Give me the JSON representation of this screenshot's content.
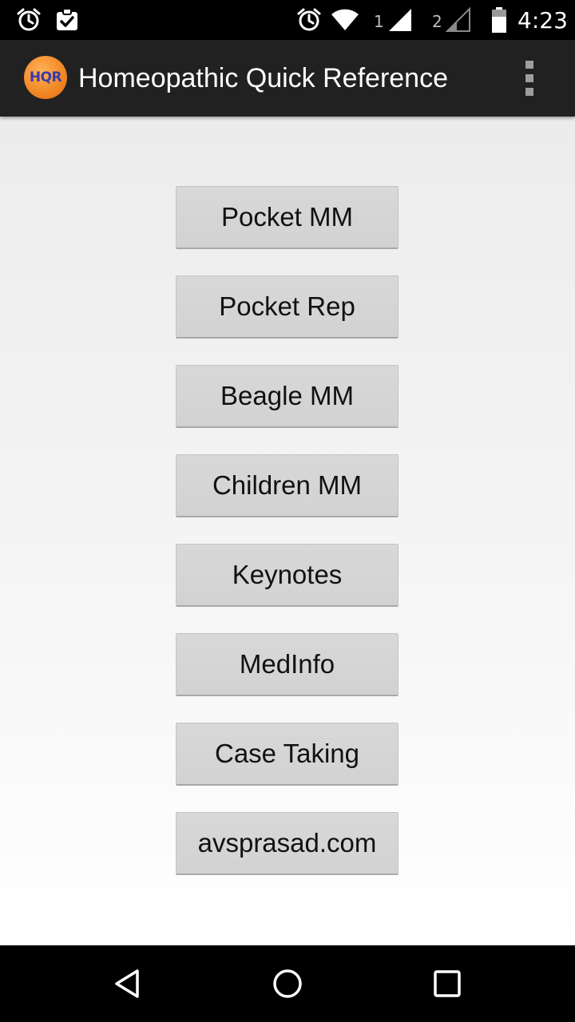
{
  "status_bar": {
    "left_icons": [
      "alarm-icon",
      "task-check-icon"
    ],
    "right_icons": [
      "alarm-icon",
      "wifi-icon",
      "signal-sim1-icon",
      "signal-sim2-icon",
      "battery-icon"
    ],
    "sim1_label": "1",
    "sim2_label": "2",
    "time": "4:23"
  },
  "action_bar": {
    "logo_text": "HQR",
    "title": "Homeopathic Quick Reference",
    "menu_icon": "overflow-menu-icon"
  },
  "menu": {
    "buttons": [
      {
        "label": "Pocket MM"
      },
      {
        "label": "Pocket Rep"
      },
      {
        "label": "Beagle MM"
      },
      {
        "label": "Children MM"
      },
      {
        "label": "Keynotes"
      },
      {
        "label": "MedInfo"
      },
      {
        "label": "Case Taking"
      },
      {
        "label": "avsprasad.com"
      }
    ]
  },
  "nav_bar": {
    "icons": [
      "back-icon",
      "home-icon",
      "recents-icon"
    ]
  },
  "colors": {
    "status_bar": "#000000",
    "action_bar": "#212121",
    "button_bg": "#d6d6d6",
    "logo_orange": "#f28a28",
    "logo_text": "#3a3aa8"
  }
}
